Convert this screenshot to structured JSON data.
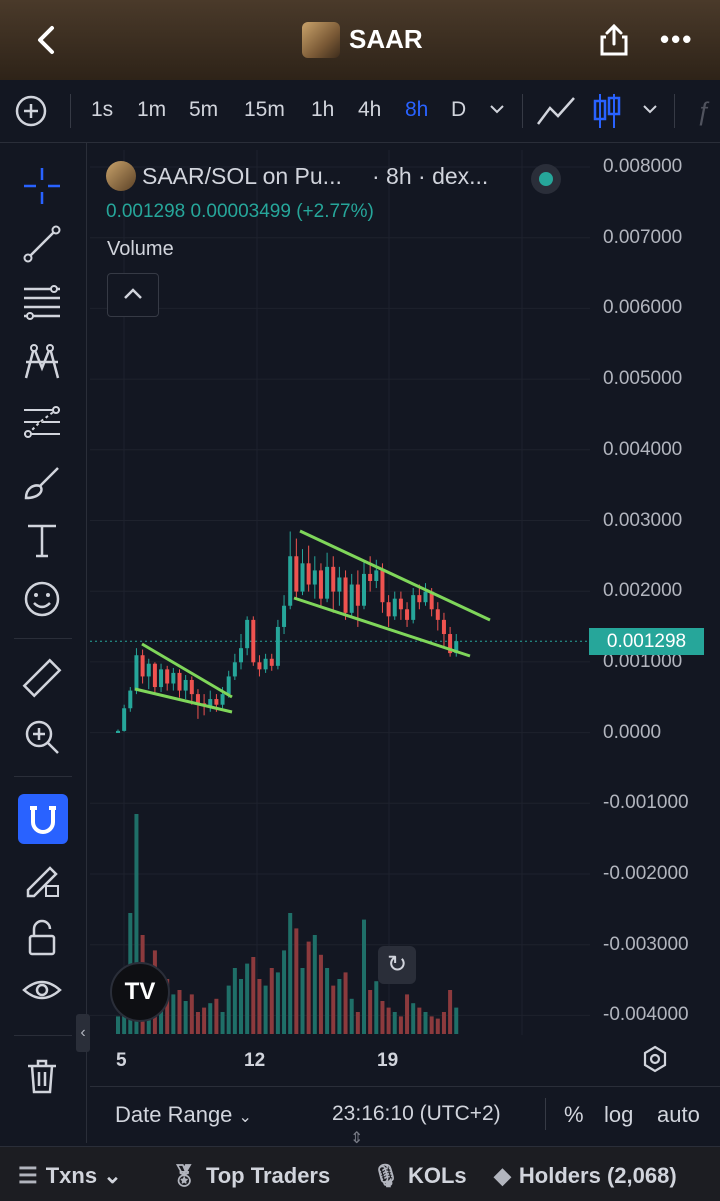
{
  "header": {
    "token_name": "SAAR"
  },
  "timeframes": {
    "items": [
      "1s",
      "1m",
      "5m",
      "15m",
      "1h",
      "4h",
      "8h",
      "D"
    ],
    "active": "8h"
  },
  "legend": {
    "pair": "SAAR/SOL on Pu...",
    "meta": "· 8h · dex...",
    "price": "0.001298",
    "change": "0.00003499",
    "change_pct": "(+2.77%)",
    "volume_label": "Volume"
  },
  "colors": {
    "up": "#26a69a",
    "down": "#ef5350",
    "trendline": "#7fd65a",
    "accent": "#2962ff"
  },
  "chart_data": {
    "type": "candlestick",
    "y_ticks": [
      "0.008000",
      "0.007000",
      "0.006000",
      "0.005000",
      "0.004000",
      "0.003000",
      "0.002000",
      "0.001000",
      "0.0000",
      "-0.001000",
      "-0.002000",
      "-0.003000",
      "-0.004000"
    ],
    "x_ticks": [
      "5",
      "12",
      "19"
    ],
    "last_price_label": "0.001298",
    "candles": [
      {
        "o": 0.0,
        "c": 3e-05,
        "h": 5e-05,
        "l": 0.0
      },
      {
        "o": 3e-05,
        "c": 0.00035,
        "h": 0.0004,
        "l": 2e-05
      },
      {
        "o": 0.00035,
        "c": 0.0006,
        "h": 0.00065,
        "l": 0.0003
      },
      {
        "o": 0.0006,
        "c": 0.0011,
        "h": 0.0012,
        "l": 0.00055
      },
      {
        "o": 0.0011,
        "c": 0.0008,
        "h": 0.00118,
        "l": 0.0007
      },
      {
        "o": 0.0008,
        "c": 0.00098,
        "h": 0.00105,
        "l": 0.00062
      },
      {
        "o": 0.00098,
        "c": 0.00065,
        "h": 0.001,
        "l": 0.00055
      },
      {
        "o": 0.00065,
        "c": 0.0009,
        "h": 0.00098,
        "l": 0.00058
      },
      {
        "o": 0.0009,
        "c": 0.0007,
        "h": 0.00095,
        "l": 0.0006
      },
      {
        "o": 0.0007,
        "c": 0.00085,
        "h": 0.00092,
        "l": 0.0006
      },
      {
        "o": 0.00085,
        "c": 0.0006,
        "h": 0.0009,
        "l": 0.0005
      },
      {
        "o": 0.0006,
        "c": 0.00075,
        "h": 0.00082,
        "l": 0.00048
      },
      {
        "o": 0.00075,
        "c": 0.00055,
        "h": 0.0008,
        "l": 0.0004
      },
      {
        "o": 0.00055,
        "c": 0.00042,
        "h": 0.00062,
        "l": 0.0002
      },
      {
        "o": 0.00042,
        "c": 0.00038,
        "h": 0.00055,
        "l": 0.00025
      },
      {
        "o": 0.00038,
        "c": 0.00048,
        "h": 0.0006,
        "l": 0.0003
      },
      {
        "o": 0.00048,
        "c": 0.0004,
        "h": 0.00055,
        "l": 0.0003
      },
      {
        "o": 0.0004,
        "c": 0.00055,
        "h": 0.00065,
        "l": 0.00035
      },
      {
        "o": 0.00055,
        "c": 0.0008,
        "h": 0.00088,
        "l": 0.0005
      },
      {
        "o": 0.0008,
        "c": 0.001,
        "h": 0.00112,
        "l": 0.00075
      },
      {
        "o": 0.001,
        "c": 0.0012,
        "h": 0.0014,
        "l": 0.0009
      },
      {
        "o": 0.0012,
        "c": 0.0016,
        "h": 0.00165,
        "l": 0.0011
      },
      {
        "o": 0.0016,
        "c": 0.001,
        "h": 0.00165,
        "l": 0.00095
      },
      {
        "o": 0.001,
        "c": 0.0009,
        "h": 0.0011,
        "l": 0.0008
      },
      {
        "o": 0.0009,
        "c": 0.00105,
        "h": 0.00112,
        "l": 0.00085
      },
      {
        "o": 0.00105,
        "c": 0.00095,
        "h": 0.00112,
        "l": 0.00088
      },
      {
        "o": 0.00095,
        "c": 0.0015,
        "h": 0.0016,
        "l": 0.0009
      },
      {
        "o": 0.0015,
        "c": 0.0018,
        "h": 0.00195,
        "l": 0.0014
      },
      {
        "o": 0.0018,
        "c": 0.0025,
        "h": 0.00285,
        "l": 0.00175
      },
      {
        "o": 0.0025,
        "c": 0.002,
        "h": 0.00275,
        "l": 0.0019
      },
      {
        "o": 0.002,
        "c": 0.0024,
        "h": 0.0026,
        "l": 0.00195
      },
      {
        "o": 0.0024,
        "c": 0.0021,
        "h": 0.00265,
        "l": 0.002
      },
      {
        "o": 0.0021,
        "c": 0.0023,
        "h": 0.0025,
        "l": 0.0019
      },
      {
        "o": 0.0023,
        "c": 0.0019,
        "h": 0.0024,
        "l": 0.0018
      },
      {
        "o": 0.0019,
        "c": 0.00235,
        "h": 0.00255,
        "l": 0.00185
      },
      {
        "o": 0.00235,
        "c": 0.002,
        "h": 0.0025,
        "l": 0.0017
      },
      {
        "o": 0.002,
        "c": 0.0022,
        "h": 0.00235,
        "l": 0.0018
      },
      {
        "o": 0.0022,
        "c": 0.0017,
        "h": 0.0023,
        "l": 0.0016
      },
      {
        "o": 0.0017,
        "c": 0.0021,
        "h": 0.00225,
        "l": 0.00165
      },
      {
        "o": 0.0021,
        "c": 0.0018,
        "h": 0.0023,
        "l": 0.0015
      },
      {
        "o": 0.0018,
        "c": 0.00225,
        "h": 0.00245,
        "l": 0.00175
      },
      {
        "o": 0.00225,
        "c": 0.00215,
        "h": 0.0025,
        "l": 0.002
      },
      {
        "o": 0.00215,
        "c": 0.0023,
        "h": 0.00245,
        "l": 0.00205
      },
      {
        "o": 0.0023,
        "c": 0.00185,
        "h": 0.0024,
        "l": 0.0017
      },
      {
        "o": 0.00185,
        "c": 0.00165,
        "h": 0.00195,
        "l": 0.0015
      },
      {
        "o": 0.00165,
        "c": 0.0019,
        "h": 0.002,
        "l": 0.0016
      },
      {
        "o": 0.0019,
        "c": 0.00175,
        "h": 0.002,
        "l": 0.0016
      },
      {
        "o": 0.00175,
        "c": 0.0016,
        "h": 0.00185,
        "l": 0.0015
      },
      {
        "o": 0.0016,
        "c": 0.00195,
        "h": 0.00205,
        "l": 0.00155
      },
      {
        "o": 0.00195,
        "c": 0.00185,
        "h": 0.0021,
        "l": 0.00175
      },
      {
        "o": 0.00185,
        "c": 0.002,
        "h": 0.00212,
        "l": 0.0018
      },
      {
        "o": 0.002,
        "c": 0.00175,
        "h": 0.00205,
        "l": 0.00165
      },
      {
        "o": 0.00175,
        "c": 0.0016,
        "h": 0.00185,
        "l": 0.00145
      },
      {
        "o": 0.0016,
        "c": 0.0014,
        "h": 0.0017,
        "l": 0.0012
      },
      {
        "o": 0.0014,
        "c": 0.00113,
        "h": 0.0015,
        "l": 0.00108
      },
      {
        "o": 0.00113,
        "c": 0.0013,
        "h": 0.0014,
        "l": 0.00108
      }
    ],
    "volume_rel": [
      0.08,
      0.1,
      0.55,
      1.0,
      0.45,
      0.3,
      0.38,
      0.22,
      0.25,
      0.18,
      0.2,
      0.15,
      0.18,
      0.1,
      0.12,
      0.14,
      0.16,
      0.1,
      0.22,
      0.3,
      0.25,
      0.32,
      0.35,
      0.25,
      0.22,
      0.3,
      0.28,
      0.38,
      0.55,
      0.48,
      0.3,
      0.42,
      0.45,
      0.36,
      0.3,
      0.22,
      0.25,
      0.28,
      0.16,
      0.1,
      0.52,
      0.2,
      0.24,
      0.15,
      0.12,
      0.1,
      0.08,
      0.18,
      0.14,
      0.12,
      0.1,
      0.08,
      0.07,
      0.1,
      0.2,
      0.12
    ]
  },
  "bottom": {
    "date_range": "Date Range",
    "clock": "23:16:10 (UTC+2)",
    "pct": "%",
    "log": "log",
    "auto": "auto"
  },
  "tabs": {
    "txns": "Txns",
    "top_traders": "Top Traders",
    "kols": "KOLs",
    "holders": "Holders (2,068)"
  },
  "icons": [
    "back-icon",
    "share-icon",
    "more-icon",
    "crosshair-icon",
    "trendline-icon",
    "fib-icon",
    "pattern-icon",
    "prediction-icon",
    "brush-icon",
    "text-icon",
    "emoji-icon",
    "ruler-icon",
    "zoom-in-icon",
    "magnet-icon",
    "pencil-lock-icon",
    "lock-icon",
    "eye-icon",
    "trash-icon",
    "settings-icon",
    "reset-icon"
  ]
}
